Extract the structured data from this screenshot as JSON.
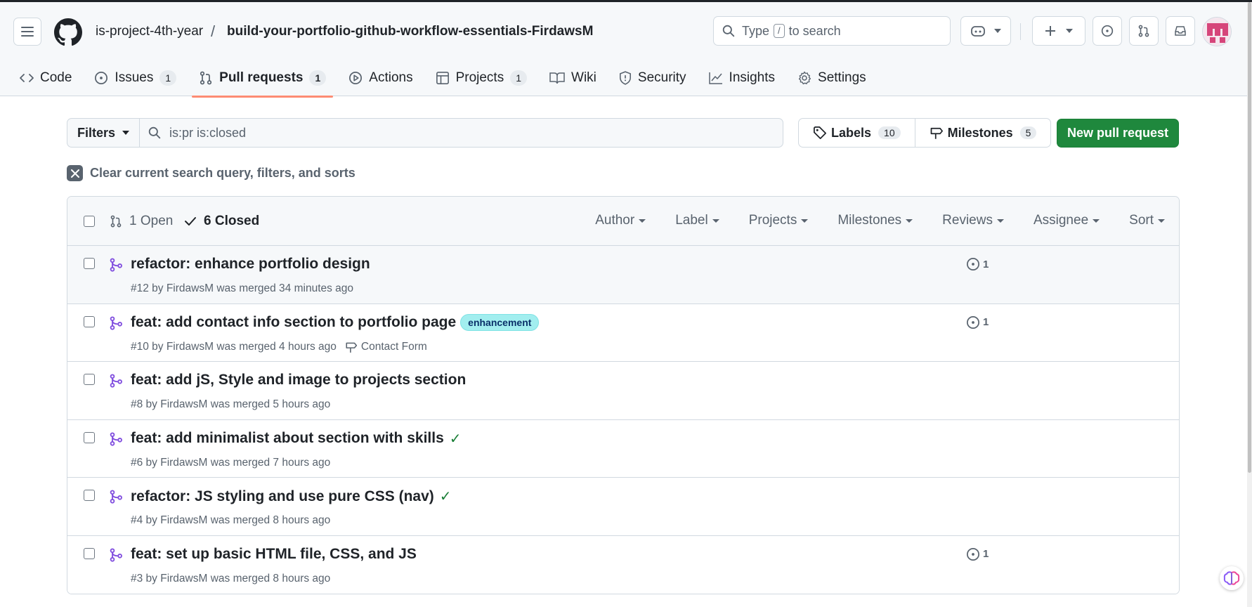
{
  "header": {
    "owner": "is-project-4th-year",
    "separator": "/",
    "repo": "build-your-portfolio-github-workflow-essentials-FirdawsM",
    "search_prefix": "Type",
    "search_key": "/",
    "search_suffix": "to search"
  },
  "tabs": [
    {
      "label": "Code",
      "icon": "code-icon"
    },
    {
      "label": "Issues",
      "count": "1",
      "icon": "issue-icon"
    },
    {
      "label": "Pull requests",
      "count": "1",
      "icon": "pull-request-icon",
      "active": true
    },
    {
      "label": "Actions",
      "icon": "play-icon"
    },
    {
      "label": "Projects",
      "count": "1",
      "icon": "table-icon"
    },
    {
      "label": "Wiki",
      "icon": "book-icon"
    },
    {
      "label": "Security",
      "icon": "shield-icon"
    },
    {
      "label": "Insights",
      "icon": "graph-icon"
    },
    {
      "label": "Settings",
      "icon": "gear-icon"
    }
  ],
  "toolbar": {
    "filters_label": "Filters",
    "query": "is:pr is:closed",
    "labels_label": "Labels",
    "labels_count": "10",
    "milestones_label": "Milestones",
    "milestones_count": "5",
    "new_pr_label": "New pull request",
    "clear_label": "Clear current search query, filters, and sorts"
  },
  "list_header": {
    "open_label": "1 Open",
    "closed_label": "6 Closed",
    "filters": [
      "Author",
      "Label",
      "Projects",
      "Milestones",
      "Reviews",
      "Assignee",
      "Sort"
    ]
  },
  "pull_requests": [
    {
      "title": "refactor: enhance portfolio design",
      "meta": "#12 by FirdawsM was merged 34 minutes ago",
      "linked": "1"
    },
    {
      "title": "feat: add contact info section to portfolio page",
      "label": "enhancement",
      "meta": "#10 by FirdawsM was merged 4 hours ago",
      "milestone": "Contact Form",
      "linked": "1"
    },
    {
      "title": "feat: add jS, Style and image to projects section",
      "meta": "#8 by FirdawsM was merged 5 hours ago"
    },
    {
      "title": "feat: add minimalist about section with skills",
      "check": "✓",
      "meta": "#6 by FirdawsM was merged 7 hours ago"
    },
    {
      "title": "refactor: JS styling and use pure CSS (nav)",
      "check": "✓",
      "meta": "#4 by FirdawsM was merged 8 hours ago"
    },
    {
      "title": "feat: set up basic HTML file, CSS, and JS",
      "meta": "#3 by FirdawsM was merged 8 hours ago",
      "linked": "1"
    }
  ],
  "colors": {
    "primary_button": "#1f883d",
    "merged": "#8250df",
    "active_tab_underline": "#fd8c73",
    "label_bg": "#a2eeef"
  }
}
